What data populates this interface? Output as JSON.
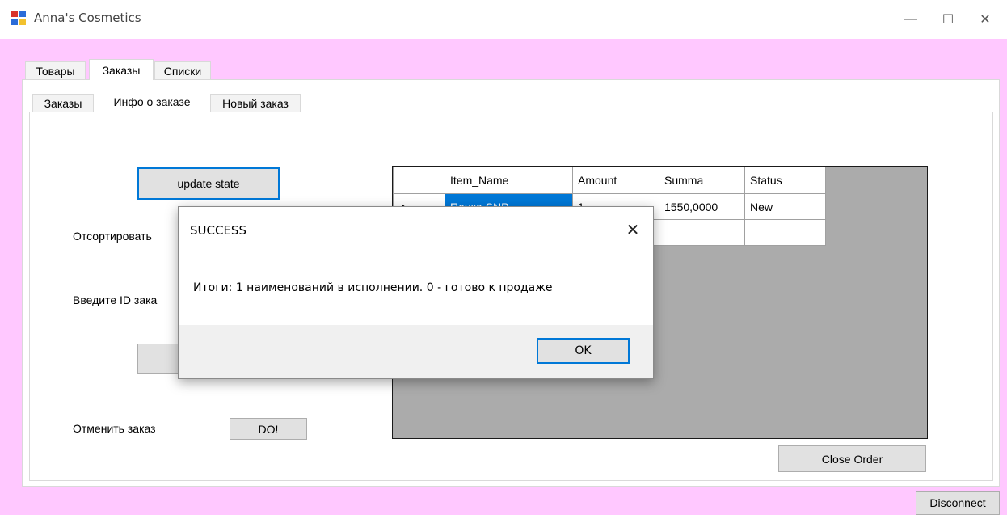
{
  "window": {
    "title": "Anna's Cosmetics",
    "minimize_glyph": "—",
    "maximize_glyph": "☐",
    "close_glyph": "✕"
  },
  "outer_tabs": [
    {
      "label": "Товары",
      "active": false
    },
    {
      "label": "Заказы",
      "active": true
    },
    {
      "label": "Списки",
      "active": false
    }
  ],
  "inner_tabs": [
    {
      "label": "Заказы",
      "active": false
    },
    {
      "label": "Инфо о заказе",
      "active": true
    },
    {
      "label": "Новый заказ",
      "active": false
    }
  ],
  "form": {
    "update_state_label": "update state",
    "sort_label": "Отсортировать",
    "enter_id_label": "Введите ID зака",
    "cancel_order_label": "Отменить заказ",
    "do_button_label": "DO!",
    "close_order_label": "Close Order",
    "disconnect_label": "Disconnect"
  },
  "grid": {
    "columns": [
      "Item_Name",
      "Amount",
      "Summa",
      "Status"
    ],
    "rows": [
      {
        "cells": [
          "Пенка SNP",
          "1",
          "1550,0000",
          "New"
        ],
        "current": true
      },
      {
        "cells": [
          "",
          "",
          "",
          ""
        ],
        "current": false
      }
    ]
  },
  "dialog": {
    "title": "SUCCESS",
    "message": "Итоги: 1 наименований в исполнении. 0 - готово к продаже",
    "ok_label": "OK"
  },
  "colors": {
    "form_background": "#ffc8ff",
    "accent": "#0078d7"
  }
}
